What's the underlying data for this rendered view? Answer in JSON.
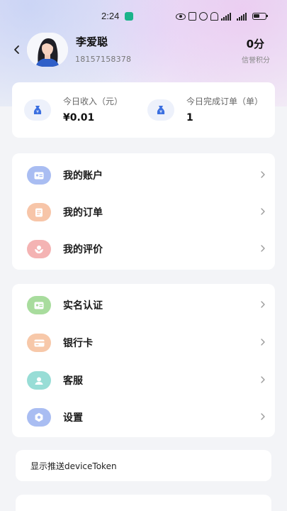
{
  "status_bar": {
    "time": "2:24"
  },
  "header": {
    "user_name": "李爱聪",
    "phone": "18157158378",
    "score_value": "0分",
    "score_label": "信誉积分"
  },
  "stats": [
    {
      "label": "今日收入（元）",
      "value": "¥0.01",
      "icon": "money-bag-icon"
    },
    {
      "label": "今日完成订单（单）",
      "value": "1",
      "icon": "money-bag-icon"
    }
  ],
  "menu_group_1": [
    {
      "label": "我的账户",
      "icon": "id-card-icon",
      "color": "#a9bdf2"
    },
    {
      "label": "我的订单",
      "icon": "document-icon",
      "color": "#f7c5a8"
    },
    {
      "label": "我的评价",
      "icon": "flower-icon",
      "color": "#f4b3b3"
    }
  ],
  "menu_group_2": [
    {
      "label": "实名认证",
      "icon": "verify-card-icon",
      "color": "#a8dc9d"
    },
    {
      "label": "银行卡",
      "icon": "bank-card-icon",
      "color": "#f7c8a9"
    },
    {
      "label": "客服",
      "icon": "customer-service-icon",
      "color": "#98ddd6"
    },
    {
      "label": "设置",
      "icon": "gear-icon",
      "color": "#a9bdf2"
    }
  ],
  "token": {
    "label": "显示推送deviceToken"
  }
}
